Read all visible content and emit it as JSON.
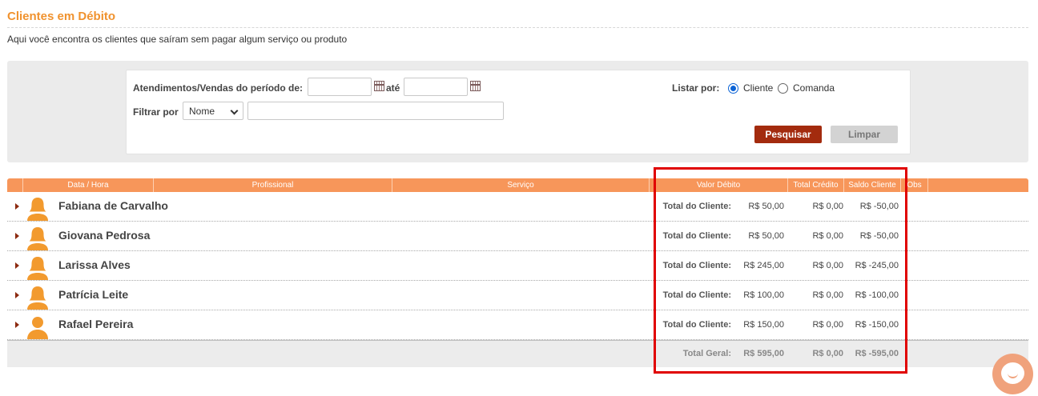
{
  "page": {
    "title": "Clientes em Débito",
    "subtitle": "Aqui você encontra os clientes que saíram sem pagar algum serviço ou produto"
  },
  "filters": {
    "period_label": "Atendimentos/Vendas do período de:",
    "date_from": "",
    "date_to": "",
    "until_label": "até",
    "filter_label": "Filtrar por",
    "filter_selected": "Nome",
    "filter_text": "",
    "list_by_label": "Listar por:",
    "list_by_options": [
      "Cliente",
      "Comanda"
    ],
    "list_by_selected": "Cliente",
    "search_button": "Pesquisar",
    "clear_button": "Limpar"
  },
  "table": {
    "headers": [
      "Data / Hora",
      "Profissional",
      "Serviço",
      "Valor Débito",
      "Total Crédito",
      "Saldo Cliente",
      "Obs"
    ],
    "row_total_label": "Total do Cliente:",
    "rows": [
      {
        "name": "Fabiana de Carvalho",
        "debit": "R$ 50,00",
        "credit": "R$ 0,00",
        "balance": "R$ -50,00",
        "avatar": "female-avatar-icon"
      },
      {
        "name": "Giovana Pedrosa",
        "debit": "R$ 50,00",
        "credit": "R$ 0,00",
        "balance": "R$ -50,00",
        "avatar": "female-avatar-icon"
      },
      {
        "name": "Larissa Alves",
        "debit": "R$ 245,00",
        "credit": "R$ 0,00",
        "balance": "R$ -245,00",
        "avatar": "female-avatar-icon"
      },
      {
        "name": "Patrícia Leite",
        "debit": "R$ 100,00",
        "credit": "R$ 0,00",
        "balance": "R$ -100,00",
        "avatar": "female-avatar-icon"
      },
      {
        "name": "Rafael Pereira",
        "debit": "R$ 150,00",
        "credit": "R$ 0,00",
        "balance": "R$ -150,00",
        "avatar": "male-avatar-icon"
      }
    ],
    "grand_total": {
      "label": "Total Geral:",
      "debit": "R$ 595,00",
      "credit": "R$ 0,00",
      "balance": "R$ -595,00"
    }
  },
  "colors": {
    "accent": "#f0922e",
    "header": "#f7965a",
    "primary_button": "#a32b0e",
    "highlight": "#e00000",
    "chat": "#f0a27c"
  }
}
